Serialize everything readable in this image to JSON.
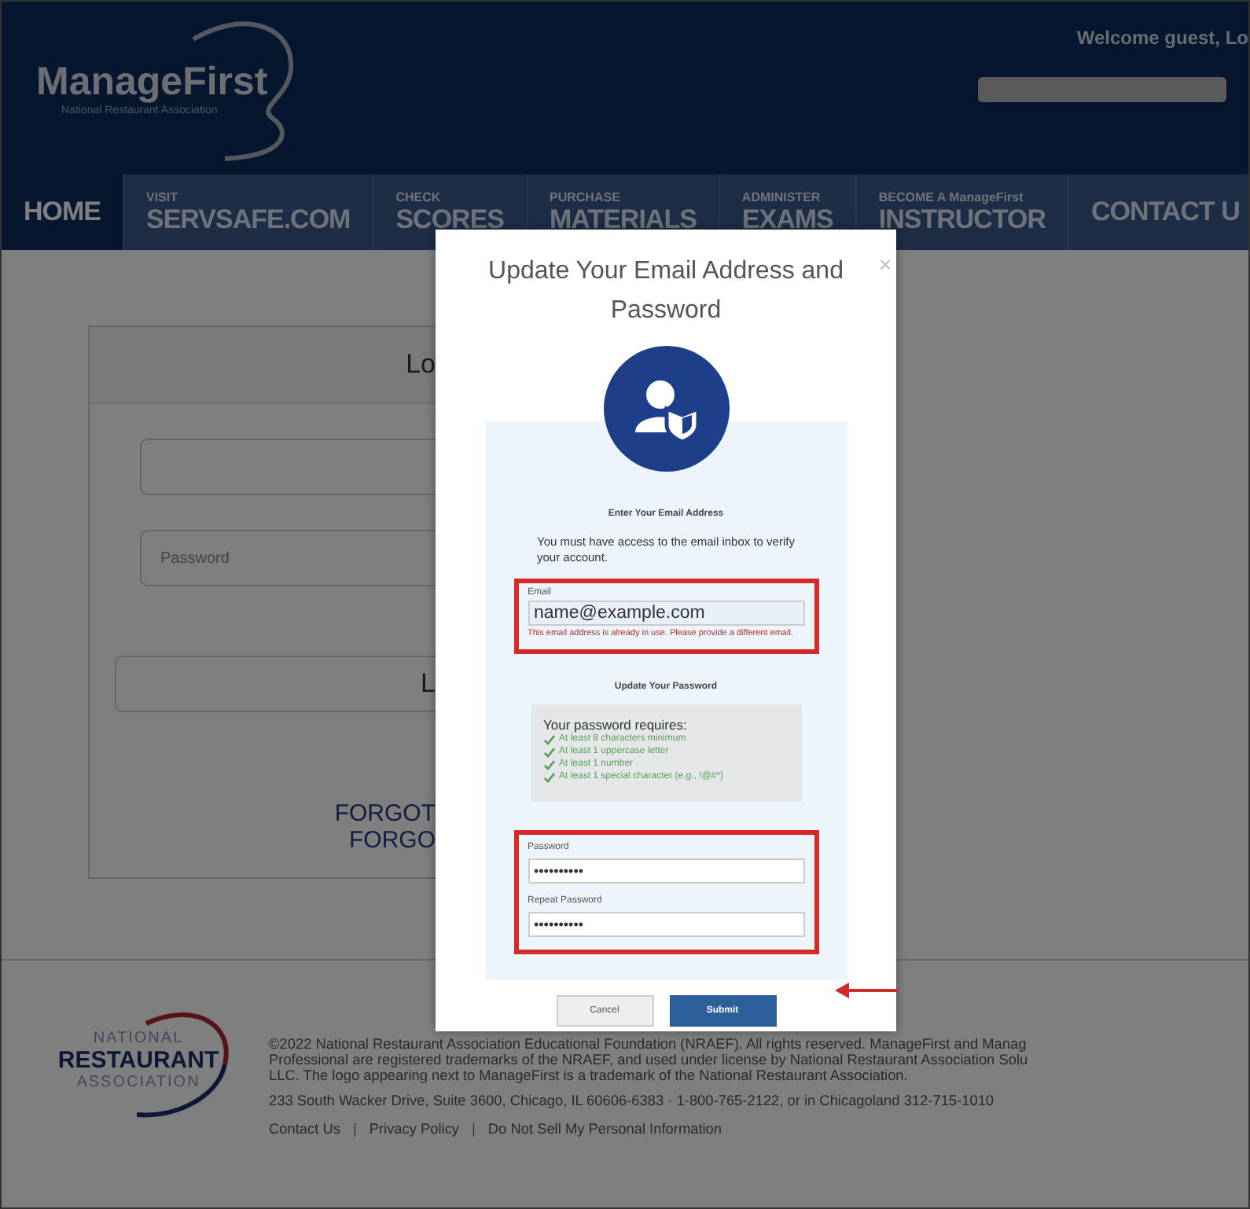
{
  "header": {
    "logo": {
      "name": "ManageFirst",
      "tagline": "National Restaurant Association"
    },
    "welcome": "Welcome guest, Lo"
  },
  "nav": [
    {
      "lines": [
        "HOME"
      ],
      "selected": true
    },
    {
      "lines": [
        "VISIT",
        "SERVSAFE.COM"
      ],
      "selected": false
    },
    {
      "lines": [
        "CHECK",
        "SCORES"
      ],
      "selected": false
    },
    {
      "lines": [
        "PURCHASE",
        "MATERIALS"
      ],
      "selected": false
    },
    {
      "lines": [
        "ADMINISTER",
        "EXAMS"
      ],
      "selected": false
    },
    {
      "lines": [
        "BECOME A ManageFirst",
        "INSTRUCTOR"
      ],
      "selected": false
    },
    {
      "lines": [
        "CONTACT U"
      ],
      "selected": false
    }
  ],
  "login_card": {
    "title": "Lo",
    "password_placeholder": "Password",
    "button": "L",
    "links": [
      "FORGOT",
      "FORGO"
    ]
  },
  "dialog": {
    "close": "×",
    "title": "Update Your Email Address and Password",
    "email_heading": "Enter Your Email Address",
    "email_note": "You must have access to the email inbox to verify your account.",
    "email": {
      "label": "Email",
      "value": "name@example.com",
      "error": "This email address is already in use. Please provide a different email."
    },
    "password_heading": "Update Your Password",
    "requirements": {
      "title": "Your password requires:",
      "items": [
        {
          "text": "At least 8 characters minimum",
          "met": true
        },
        {
          "text": "At least 1 uppercase letter",
          "met": true
        },
        {
          "text": "At least 1 number",
          "met": true
        },
        {
          "text": "At least 1 special character (e.g., !@#*)",
          "met": true
        }
      ]
    },
    "password": {
      "label": "Password",
      "value": "••••••••••"
    },
    "repeat_password": {
      "label": "Repeat Password",
      "value": "••••••••••"
    },
    "buttons": {
      "cancel": "Cancel",
      "submit": "Submit"
    }
  },
  "footer": {
    "logo": [
      "NATIONAL",
      "RESTAURANT",
      "ASSOCIATION"
    ],
    "lines": [
      "©2022 National Restaurant Association Educational Foundation (NRAEF). All rights reserved. ManageFirst and Manag",
      "Professional are registered trademarks of the NRAEF, and used under license by National Restaurant Association Solu",
      "LLC. The logo appearing next to ManageFirst is a trademark of the National Restaurant Association."
    ],
    "address": "233 South Wacker Drive, Suite 3600, Chicago, IL 60606-6383 · 1-800-765-2122, or in Chicagoland 312-715-1010",
    "links": [
      "Contact Us",
      "Privacy Policy",
      "Do Not Sell My Personal Information"
    ],
    "separator": "|"
  }
}
